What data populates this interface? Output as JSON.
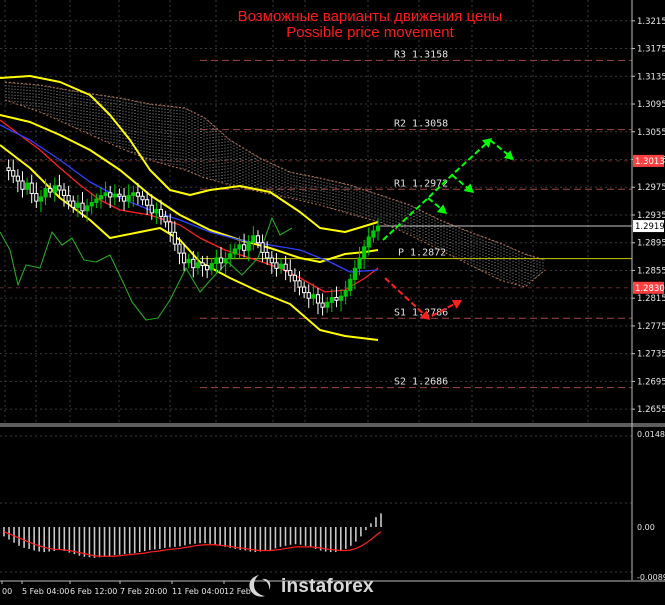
{
  "header": {
    "title_ru": "Возможные варианты движения цены",
    "title_en": "Possible price movement"
  },
  "watermark": {
    "text": "instaforex"
  },
  "colors": {
    "background": "#000000",
    "grid": "#3a3a3a",
    "title": "#ff1a1a",
    "bull_candle": "#00c800",
    "bear_candle": "#ffffff",
    "bollinger": "#ffff00",
    "tenkan": "#ff2020",
    "kijun": "#3040ff",
    "chikou": "#22aa22",
    "cloud": "#b87050",
    "level_line": "#a04848",
    "pivot_line": "#c8c800",
    "bull_arrow": "#00ff00",
    "bear_arrow": "#ff2020",
    "macd_hist": "#c8c8c8",
    "macd_signal": "#ff2020",
    "price_tag": "#ff4040"
  },
  "chart_data": {
    "type": "candlestick",
    "instrument": "",
    "price_axis": {
      "range": [
        1.2635,
        1.3245
      ],
      "ticks": [
        1.3215,
        1.3175,
        1.3135,
        1.3095,
        1.3055,
        1.3015,
        1.2975,
        1.2935,
        1.2895,
        1.2855,
        1.2815,
        1.2775,
        1.2735,
        1.2695,
        1.2655
      ]
    },
    "time_axis": {
      "labels": [
        "00",
        "5 Feb 04:00",
        "6 Feb 12:00",
        "7 Feb 20:00",
        "11 Feb 04:00",
        "12 Feb"
      ]
    },
    "current_price": 1.2919,
    "tagged_prices": [
      1.3013,
      1.283
    ],
    "levels": [
      {
        "label": "R3",
        "value": "1.3158"
      },
      {
        "label": "R2",
        "value": "1.3058"
      },
      {
        "label": "R1",
        "value": "1.2972"
      },
      {
        "label": "P",
        "value": "1.2872"
      },
      {
        "label": "S1",
        "value": "1.2786"
      },
      {
        "label": "S2",
        "value": "1.2686"
      }
    ],
    "macd": {
      "ticks": [
        "0.01485",
        "0.00",
        "-0.00894"
      ],
      "hist": [
        -0.0018,
        -0.0024,
        -0.003,
        -0.0036,
        -0.004,
        -0.0042,
        -0.0045,
        -0.0047,
        -0.0048,
        -0.0047,
        -0.0046,
        -0.0044,
        -0.0046,
        -0.0049,
        -0.0052,
        -0.0055,
        -0.0057,
        -0.0058,
        -0.0059,
        -0.0058,
        -0.0057,
        -0.0056,
        -0.0054,
        -0.0053,
        -0.0052,
        -0.0051,
        -0.005,
        -0.0048,
        -0.0046,
        -0.0044,
        -0.0043,
        -0.0042,
        -0.004,
        -0.0039,
        -0.0038,
        -0.0037,
        -0.0035,
        -0.0033,
        -0.0032,
        -0.0031,
        -0.0031,
        -0.0032,
        -0.0034,
        -0.0036,
        -0.0038,
        -0.004,
        -0.0042,
        -0.0044,
        -0.0045,
        -0.0047,
        -0.0048,
        -0.0047,
        -0.0046,
        -0.0044,
        -0.0041,
        -0.0038,
        -0.0036,
        -0.0034,
        -0.0033,
        -0.0034,
        -0.0036,
        -0.0039,
        -0.0042,
        -0.0045,
        -0.0047,
        -0.0048,
        -0.0048,
        -0.0046,
        -0.0042,
        -0.0036,
        -0.0028,
        -0.0018,
        -0.0006,
        0.0006,
        0.0016,
        0.0022
      ],
      "signal": [
        -0.0009,
        -0.0013,
        -0.0017,
        -0.0021,
        -0.0025,
        -0.0029,
        -0.0033,
        -0.0036,
        -0.0039,
        -0.0041,
        -0.0043,
        -0.0043,
        -0.0044,
        -0.0045,
        -0.0047,
        -0.0049,
        -0.0051,
        -0.0053,
        -0.0055,
        -0.0056,
        -0.0056,
        -0.0056,
        -0.0056,
        -0.0055,
        -0.0054,
        -0.0053,
        -0.0052,
        -0.0051,
        -0.005,
        -0.0048,
        -0.0047,
        -0.0046,
        -0.0044,
        -0.0043,
        -0.0042,
        -0.0041,
        -0.0039,
        -0.0038,
        -0.0036,
        -0.0035,
        -0.0034,
        -0.0034,
        -0.0034,
        -0.0035,
        -0.0036,
        -0.0037,
        -0.0039,
        -0.004,
        -0.0041,
        -0.0043,
        -0.0044,
        -0.0045,
        -0.0045,
        -0.0045,
        -0.0044,
        -0.0043,
        -0.0041,
        -0.004,
        -0.0038,
        -0.0038,
        -0.0038,
        -0.0038,
        -0.0039,
        -0.004,
        -0.0042,
        -0.0043,
        -0.0044,
        -0.0045,
        -0.0045,
        -0.0044,
        -0.0041,
        -0.0037,
        -0.0031,
        -0.0024,
        -0.0016,
        -0.0009
      ]
    }
  }
}
